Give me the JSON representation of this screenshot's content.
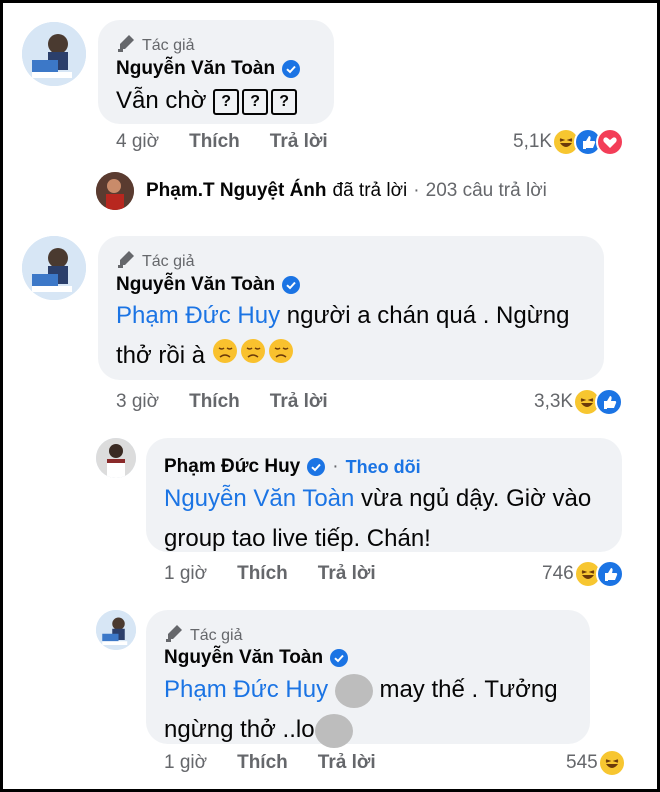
{
  "comments": [
    {
      "author_tag": "Tác giả",
      "name": "Nguyễn Văn Toàn",
      "text": "Vẫn chờ",
      "text_boxes": [
        "?",
        "?",
        "?"
      ],
      "time": "4 giờ",
      "like": "Thích",
      "reply": "Trả lời",
      "reaction_count": "5,1K",
      "reactions": [
        "haha-icon",
        "like-icon",
        "love-icon"
      ]
    },
    {
      "author_tag": "Tác giả",
      "name": "Nguyễn Văn Toàn",
      "mention": "Phạm Đức Huy",
      "text_a": "người a chán quá . Ngừng",
      "text_b": "thở rồi à",
      "time": "3 giờ",
      "like": "Thích",
      "reply": "Trả lời",
      "reaction_count": "3,3K",
      "reactions": [
        "haha-icon",
        "like-icon"
      ]
    },
    {
      "name": "Phạm Đức Huy",
      "separator": "·",
      "follow": "Theo dõi",
      "mention": "Nguyễn Văn Toàn",
      "text_a": "vừa ngủ dậy. Giờ vào",
      "text_b": "group tao live tiếp. Chán!",
      "time": "1 giờ",
      "like": "Thích",
      "reply": "Trả lời",
      "reaction_count": "746",
      "reactions": [
        "haha-icon",
        "like-icon"
      ]
    },
    {
      "author_tag": "Tác giả",
      "name": "Nguyễn Văn Toàn",
      "mention": "Phạm Đức Huy",
      "text_a": "may thế . Tưởng",
      "text_b": "ngừng thở ..lo",
      "time": "1 giờ",
      "like": "Thích",
      "reply": "Trả lời",
      "reaction_count": "545",
      "reactions": [
        "haha-icon"
      ]
    }
  ],
  "reply_summary": {
    "name": "Phạm.T Nguyệt Ánh",
    "text": "đã trả lời",
    "separator": "·",
    "count": "203 câu trả lời"
  },
  "colors": {
    "accent": "#1b74e4",
    "bubble": "#f0f2f5",
    "muted": "#65676b"
  }
}
